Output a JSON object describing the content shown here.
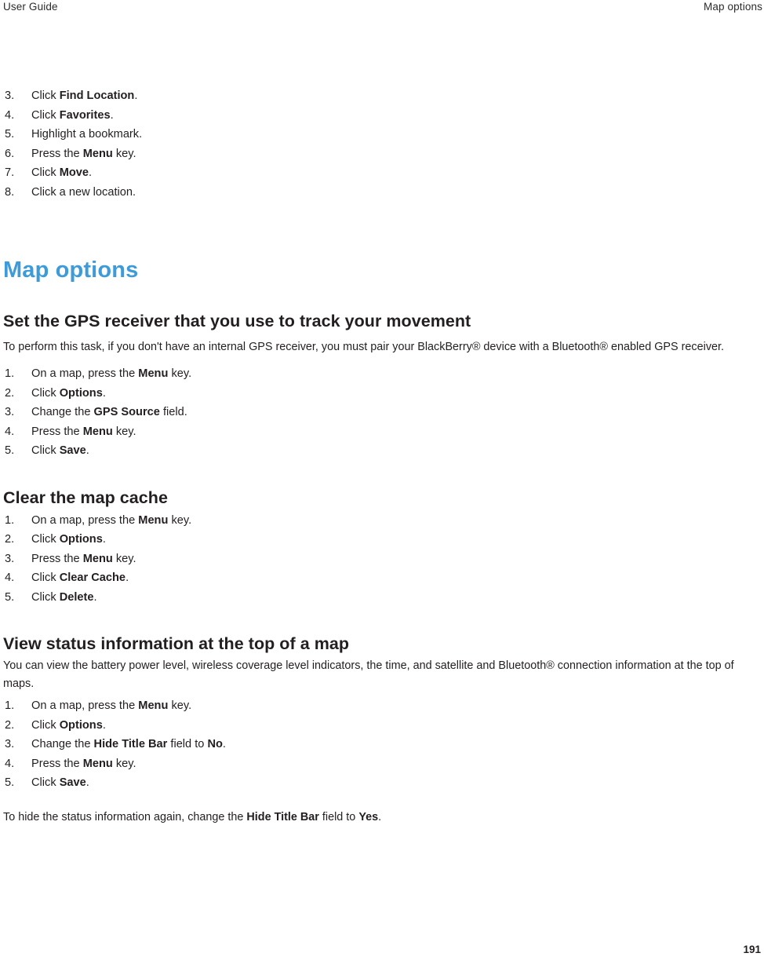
{
  "header": {
    "left": "User Guide",
    "right": "Map options"
  },
  "footer": {
    "page_number": "191"
  },
  "colors": {
    "chapter_heading": "#3d9bd9",
    "body_text": "#231f20",
    "background": "#ffffff"
  },
  "top_list": {
    "items": [
      {
        "num": "3.",
        "prefix": "Click ",
        "bold": "Find Location",
        "suffix": "."
      },
      {
        "num": "4.",
        "prefix": "Click ",
        "bold": "Favorites",
        "suffix": "."
      },
      {
        "num": "5.",
        "prefix": "Highlight a bookmark.",
        "bold": "",
        "suffix": ""
      },
      {
        "num": "6.",
        "prefix": "Press the ",
        "bold": "Menu",
        "suffix": " key."
      },
      {
        "num": "7.",
        "prefix": "Click ",
        "bold": "Move",
        "suffix": "."
      },
      {
        "num": "8.",
        "prefix": "Click a new location.",
        "bold": "",
        "suffix": ""
      }
    ]
  },
  "chapter": {
    "title": "Map options"
  },
  "sections": [
    {
      "title": "Set the GPS receiver that you use to track your movement",
      "intro": "To perform this task, if you don't have an internal GPS receiver, you must pair your BlackBerry® device with a Bluetooth® enabled GPS receiver.",
      "steps": [
        {
          "num": "1.",
          "prefix": "On a map, press the ",
          "bold": "Menu",
          "suffix": " key."
        },
        {
          "num": "2.",
          "prefix": "Click ",
          "bold": "Options",
          "suffix": "."
        },
        {
          "num": "3.",
          "prefix": "Change the ",
          "bold": "GPS Source",
          "suffix": " field."
        },
        {
          "num": "4.",
          "prefix": "Press the ",
          "bold": "Menu",
          "suffix": " key."
        },
        {
          "num": "5.",
          "prefix": "Click ",
          "bold": "Save",
          "suffix": "."
        }
      ]
    },
    {
      "title": "Clear the map cache",
      "intro": "",
      "steps": [
        {
          "num": "1.",
          "prefix": "On a map, press the ",
          "bold": "Menu",
          "suffix": " key."
        },
        {
          "num": "2.",
          "prefix": "Click ",
          "bold": "Options",
          "suffix": "."
        },
        {
          "num": "3.",
          "prefix": "Press the ",
          "bold": "Menu",
          "suffix": " key."
        },
        {
          "num": "4.",
          "prefix": "Click ",
          "bold": "Clear Cache",
          "suffix": "."
        },
        {
          "num": "5.",
          "prefix": "Click ",
          "bold": "Delete",
          "suffix": "."
        }
      ]
    },
    {
      "title": "View status information at the top of a map",
      "intro": "You can view the battery power level, wireless coverage level indicators, the time, and satellite and Bluetooth® connection information at the top of maps.",
      "steps": [
        {
          "num": "1.",
          "prefix": "On a map, press the ",
          "bold": "Menu",
          "suffix": " key."
        },
        {
          "num": "2.",
          "prefix": "Click ",
          "bold": "Options",
          "suffix": "."
        },
        {
          "num": "3.",
          "prefix": "Change the ",
          "bold": "Hide Title Bar",
          "suffix": " field to ",
          "bold2": "No",
          "suffix2": "."
        },
        {
          "num": "4.",
          "prefix": "Press the ",
          "bold": "Menu",
          "suffix": " key."
        },
        {
          "num": "5.",
          "prefix": "Click ",
          "bold": "Save",
          "suffix": "."
        }
      ],
      "note": {
        "prefix": "To hide the status information again, change the ",
        "bold": "Hide Title Bar",
        "suffix": " field to ",
        "bold2": "Yes",
        "suffix2": "."
      }
    }
  ]
}
